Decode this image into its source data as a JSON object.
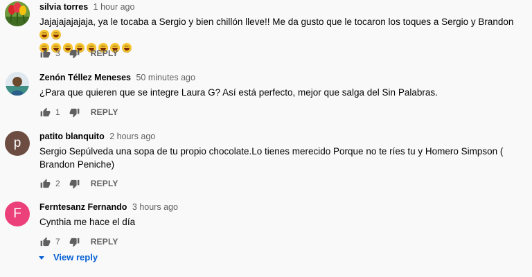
{
  "comments": [
    {
      "author": "silvia torres",
      "time": "1 hour ago",
      "text": "Jajajajajajaja, ya le tocaba a Sergio y  bien chillón lleve!! Me da gusto que le tocaron los toques a Sergio y Brandon",
      "emoji_inline_count": 2,
      "emoji_line_count": 8,
      "likes": "3",
      "reply_label": "REPLY",
      "avatar_icon": "tulips-photo"
    },
    {
      "author": "Zenón Téllez Meneses",
      "time": "50 minutes ago",
      "text": "¿Para que quieren que se integre Laura G? Así está perfecto, mejor que salga del Sin Palabras.",
      "likes": "1",
      "reply_label": "REPLY",
      "avatar_icon": "person-photo"
    },
    {
      "author": "patito blanquito",
      "time": "2 hours ago",
      "text": "Sergio Sepúlveda una sopa de tu propio chocolate.Lo tienes merecido Porque no te ríes tu y Homero Simpson ( Brandon Peniche)",
      "likes": "2",
      "reply_label": "REPLY",
      "avatar_letter": "p",
      "avatar_color": "#6d4c41"
    },
    {
      "author": "Ferntesanz Fernando",
      "time": "3 hours ago",
      "text": "Cynthia me hace el día",
      "likes": "7",
      "reply_label": "REPLY",
      "avatar_letter": "F",
      "avatar_color": "#ec407a"
    }
  ],
  "view_reply_label": "View reply",
  "colors": {
    "link": "#065fd4",
    "secondary_text": "#606060",
    "background": "#f9f9f9"
  }
}
